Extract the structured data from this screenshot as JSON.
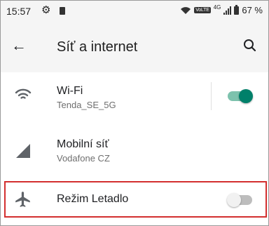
{
  "status_bar": {
    "time": "15:57",
    "network_type": "4G",
    "volte_label": "VoLTE",
    "battery": "67 %"
  },
  "app_bar": {
    "title": "Síť a internet",
    "back_icon": "arrow-left-icon",
    "search_icon": "search-icon"
  },
  "settings": {
    "wifi": {
      "label": "Wi-Fi",
      "network": "Tenda_SE_5G",
      "enabled": true
    },
    "mobile": {
      "label": "Mobilní síť",
      "operator": "Vodafone CZ"
    },
    "airplane": {
      "label": "Režim Letadlo",
      "enabled": false
    }
  },
  "colors": {
    "accent": "#00806a",
    "highlight_border": "#d32f2f",
    "header_bg": "#f5f5f5"
  }
}
